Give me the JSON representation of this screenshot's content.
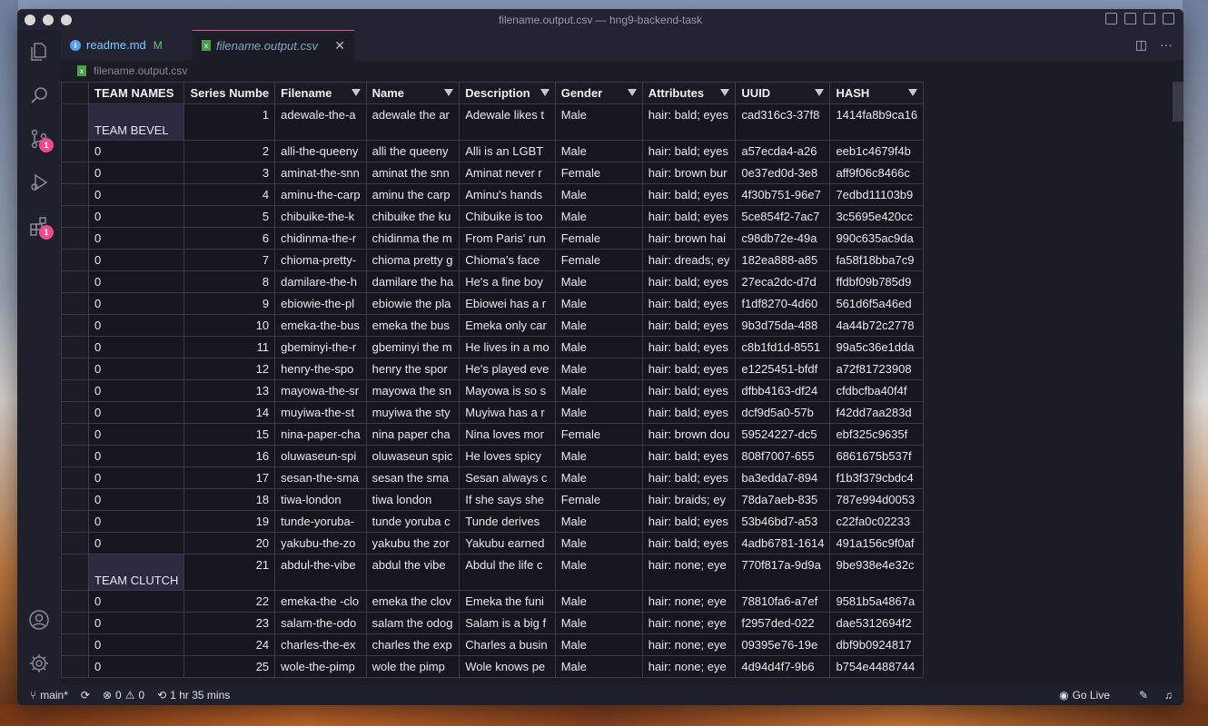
{
  "window": {
    "title": "filename.output.csv — hng9-backend-task"
  },
  "activity_bar": {
    "scm_badge": "1",
    "extensions_badge": "1"
  },
  "tabs": [
    {
      "label": "readme.md",
      "status": "M"
    },
    {
      "label": "filename.output.csv"
    }
  ],
  "breadcrumb": {
    "file": "filename.output.csv"
  },
  "table": {
    "columns": [
      "TEAM NAMES",
      "Series Numbe",
      "Filename",
      "Name",
      "Description",
      "Gender",
      "Attributes",
      "UUID",
      "HASH"
    ],
    "rows": [
      [
        "TEAM BEVEL",
        "1",
        "adewale-the-a",
        "adewale the ar",
        "Adewale likes t",
        "Male",
        "hair: bald; eyes",
        "cad316c3-37f8",
        "1414fa8b9ca16"
      ],
      [
        "0",
        "2",
        "alli-the-queeny",
        "alli the queeny",
        "Alli is an LGBT",
        "Male",
        "hair: bald; eyes",
        "a57ecda4-a26",
        "eeb1c4679f4b"
      ],
      [
        "0",
        "3",
        "aminat-the-snn",
        "aminat the snn",
        "Aminat never r",
        "Female",
        "hair: brown bur",
        "0e37ed0d-3e8",
        "aff9f06c8466c"
      ],
      [
        "0",
        "4",
        "aminu-the-carp",
        "aminu the carp",
        "Aminu's hands",
        "Male",
        "hair: bald; eyes",
        "4f30b751-96e7",
        "7edbd11103b9"
      ],
      [
        "0",
        "5",
        "chibuike-the-k",
        "chibuike the ku",
        "Chibuike is too",
        "Male",
        "hair: bald; eyes",
        "5ce854f2-7ac7",
        "3c5695e420cc"
      ],
      [
        "0",
        "6",
        "chidinma-the-r",
        "chidinma the m",
        "From Paris' run",
        "Female",
        "hair: brown hai",
        "c98db72e-49a",
        "990c635ac9da"
      ],
      [
        "0",
        "7",
        "chioma-pretty-",
        "chioma pretty g",
        "Chioma's face",
        "Female",
        "hair: dreads; ey",
        "182ea888-a85",
        "fa58f18bba7c9"
      ],
      [
        "0",
        "8",
        "damilare-the-h",
        "damilare the ha",
        "He's a fine boy",
        "Male",
        "hair: bald; eyes",
        "27eca2dc-d7d",
        "ffdbf09b785d9"
      ],
      [
        "0",
        "9",
        "ebiowie-the-pl",
        "ebiowie the pla",
        "Ebiowei has a r",
        "Male",
        "hair: bald; eyes",
        "f1df8270-4d60",
        "561d6f5a46ed"
      ],
      [
        "0",
        "10",
        "emeka-the-bus",
        "emeka the bus",
        "Emeka only car",
        "Male",
        "hair: bald; eyes",
        "9b3d75da-488",
        "4a44b72c2778"
      ],
      [
        "0",
        "11",
        "gbeminyi-the-r",
        "gbeminyi the m",
        "He lives in a mo",
        "Male",
        "hair: bald; eyes",
        "c8b1fd1d-8551",
        "99a5c36e1dda"
      ],
      [
        "0",
        "12",
        "henry-the-spo",
        "henry the spor",
        "He's played eve",
        "Male",
        "hair: bald; eyes",
        "e1225451-bfdf",
        "a72f81723908"
      ],
      [
        "0",
        "13",
        "mayowa-the-sr",
        "mayowa the sn",
        "Mayowa is so s",
        "Male",
        "hair: bald; eyes",
        "dfbb4163-df24",
        "cfdbcfba40f4f"
      ],
      [
        "0",
        "14",
        "muyiwa-the-st",
        "muyiwa the sty",
        "Muyiwa has a r",
        "Male",
        "hair: bald; eyes",
        "dcf9d5a0-57b",
        "f42dd7aa283d"
      ],
      [
        "0",
        "15",
        "nina-paper-cha",
        "nina paper cha",
        "Nina loves mor",
        "Female",
        "hair: brown dou",
        "59524227-dc5",
        "ebf325c9635f"
      ],
      [
        "0",
        "16",
        "oluwaseun-spi",
        "oluwaseun spic",
        "He loves spicy",
        "Male",
        "hair: bald; eyes",
        "808f7007-655",
        "6861675b537f"
      ],
      [
        "0",
        "17",
        "sesan-the-sma",
        "sesan the sma",
        "Sesan always c",
        "Male",
        "hair: bald; eyes",
        "ba3edda7-894",
        "f1b3f379cbdc4"
      ],
      [
        "0",
        "18",
        "tiwa-london",
        "tiwa london",
        "If she says she",
        "Female",
        "hair: braids; ey",
        "78da7aeb-835",
        "787e994d0053"
      ],
      [
        "0",
        "19",
        "tunde-yoruba-",
        "tunde yoruba c",
        "Tunde derives",
        "Male",
        "hair: bald; eyes",
        "53b46bd7-a53",
        "c22fa0c02233"
      ],
      [
        "0",
        "20",
        "yakubu-the-zo",
        "yakubu the zor",
        "Yakubu earned",
        "Male",
        "hair: bald; eyes",
        "4adb6781-1614",
        "491a156c9f0af"
      ],
      [
        "TEAM CLUTCH",
        "21",
        "abdul-the-vibe",
        "abdul the vibe",
        "Abdul the life c",
        "Male",
        "hair: none; eye",
        "770f817a-9d9a",
        "9be938e4e32c"
      ],
      [
        "0",
        "22",
        "emeka-the -clo",
        "emeka the clov",
        "Emeka the funi",
        "Male",
        "hair: none; eye",
        "78810fa6-a7ef",
        "9581b5a4867a"
      ],
      [
        "0",
        "23",
        "salam-the-odo",
        "salam the odog",
        "Salam is a big f",
        "Male",
        "hair: none; eye",
        "f2957ded-022",
        "dae5312694f2"
      ],
      [
        "0",
        "24",
        "charles-the-ex",
        "charles the exp",
        "Charles a busin",
        "Male",
        "hair: none; eye",
        "09395e76-19e",
        "dbf9b0924817"
      ],
      [
        "0",
        "25",
        "wole-the-pimp",
        "wole the pimp",
        "Wole knows pe",
        "Male",
        "hair: none; eye",
        "4d94d4f7-9b6",
        "b754e4488744"
      ]
    ]
  },
  "status_bar": {
    "branch": "main*",
    "errors": "0",
    "warnings": "0",
    "time": "1 hr 35 mins",
    "go_live": "Go Live"
  }
}
